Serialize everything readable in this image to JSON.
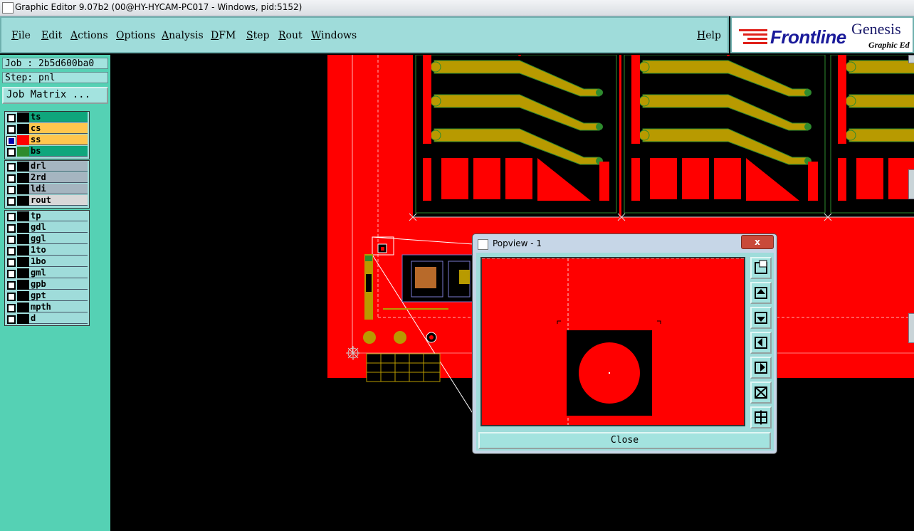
{
  "window": {
    "title": "Graphic Editor 9.07b2 (00@HY-HYCAM-PC017 - Windows, pid:5152)"
  },
  "menu": {
    "items": [
      "File",
      "Edit",
      "Actions",
      "Options",
      "Analysis",
      "DFM",
      "Step",
      "Rout",
      "Windows"
    ],
    "help": "Help"
  },
  "logo": {
    "brand": "Frontline",
    "product": "Genesis",
    "subtitle": "Graphic Ed"
  },
  "job": {
    "job_label": "Job : 2b5d600ba0",
    "step_label": "Step: pnl",
    "matrix_button": "Job Matrix ..."
  },
  "layers": {
    "group1": [
      {
        "name": "ts",
        "color": "#0fa67c",
        "checked": false,
        "swatch": "#000"
      },
      {
        "name": "cs",
        "color": "#ffc64e",
        "checked": false,
        "swatch": "#000"
      },
      {
        "name": "ss",
        "color": "#ffc64e",
        "checked": true,
        "swatch": "#ff0000"
      },
      {
        "name": "bs",
        "color": "#0fa67c",
        "checked": false,
        "swatch": "#2e8b2e"
      }
    ],
    "group2": [
      {
        "name": "drl",
        "color": "#a5b5c0",
        "checked": false,
        "swatch": "#000"
      },
      {
        "name": "2rd",
        "color": "#a5b5c0",
        "checked": false,
        "swatch": "#000"
      },
      {
        "name": "ldi",
        "color": "#a5b5c0",
        "checked": false,
        "swatch": "#000"
      },
      {
        "name": "rout",
        "color": "#d8d8d8",
        "checked": false,
        "swatch": "#000"
      }
    ],
    "group3": [
      {
        "name": "tp",
        "color": "#9fdcda",
        "checked": false,
        "swatch": "#000"
      },
      {
        "name": "gdl",
        "color": "#9fdcda",
        "checked": false,
        "swatch": "#000"
      },
      {
        "name": "ggl",
        "color": "#9fdcda",
        "checked": false,
        "swatch": "#000"
      },
      {
        "name": "1to",
        "color": "#9fdcda",
        "checked": false,
        "swatch": "#000"
      },
      {
        "name": "1bo",
        "color": "#9fdcda",
        "checked": false,
        "swatch": "#000"
      },
      {
        "name": "gml",
        "color": "#9fdcda",
        "checked": false,
        "swatch": "#000"
      },
      {
        "name": "gpb",
        "color": "#9fdcda",
        "checked": false,
        "swatch": "#000"
      },
      {
        "name": "gpt",
        "color": "#9fdcda",
        "checked": false,
        "swatch": "#000"
      },
      {
        "name": "mpth",
        "color": "#9fdcda",
        "checked": false,
        "swatch": "#000"
      },
      {
        "name": "d",
        "color": "#9fdcda",
        "checked": false,
        "swatch": "#000"
      }
    ]
  },
  "popview": {
    "title": "Popview - 1",
    "close_label": "Close",
    "close_glyph": "x"
  },
  "colors": {
    "copper": "#ff0000",
    "gold": "#b89a00",
    "accent_teal": "#9fdcda"
  }
}
